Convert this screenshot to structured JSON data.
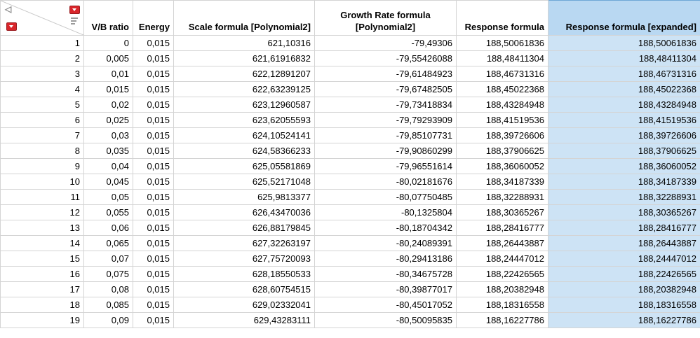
{
  "headers": {
    "vb_ratio": "V/B ratio",
    "energy": "Energy",
    "scale_formula": "Scale formula [Polynomial2]",
    "growth_line1": "Growth Rate formula",
    "growth_line2": "[Polynomial2]",
    "response_formula": "Response formula",
    "response_expanded": "Response formula [expanded]"
  },
  "icons": {
    "collapse": "triangle-left-icon",
    "column_menu": "red-dropdown-icon",
    "row_menu": "red-dropdown-icon",
    "sort": "lines-icon"
  },
  "colors": {
    "selected_column": "#cde3f5",
    "menu_red": "#d9262b"
  },
  "rows": [
    {
      "n": "1",
      "vb": "0",
      "energy": "0,015",
      "scale": "621,10316",
      "growth": "-79,49306",
      "resp": "188,50061836",
      "respx": "188,50061836"
    },
    {
      "n": "2",
      "vb": "0,005",
      "energy": "0,015",
      "scale": "621,61916832",
      "growth": "-79,55426088",
      "resp": "188,48411304",
      "respx": "188,48411304"
    },
    {
      "n": "3",
      "vb": "0,01",
      "energy": "0,015",
      "scale": "622,12891207",
      "growth": "-79,61484923",
      "resp": "188,46731316",
      "respx": "188,46731316"
    },
    {
      "n": "4",
      "vb": "0,015",
      "energy": "0,015",
      "scale": "622,63239125",
      "growth": "-79,67482505",
      "resp": "188,45022368",
      "respx": "188,45022368"
    },
    {
      "n": "5",
      "vb": "0,02",
      "energy": "0,015",
      "scale": "623,12960587",
      "growth": "-79,73418834",
      "resp": "188,43284948",
      "respx": "188,43284948"
    },
    {
      "n": "6",
      "vb": "0,025",
      "energy": "0,015",
      "scale": "623,62055593",
      "growth": "-79,79293909",
      "resp": "188,41519536",
      "respx": "188,41519536"
    },
    {
      "n": "7",
      "vb": "0,03",
      "energy": "0,015",
      "scale": "624,10524141",
      "growth": "-79,85107731",
      "resp": "188,39726606",
      "respx": "188,39726606"
    },
    {
      "n": "8",
      "vb": "0,035",
      "energy": "0,015",
      "scale": "624,58366233",
      "growth": "-79,90860299",
      "resp": "188,37906625",
      "respx": "188,37906625"
    },
    {
      "n": "9",
      "vb": "0,04",
      "energy": "0,015",
      "scale": "625,05581869",
      "growth": "-79,96551614",
      "resp": "188,36060052",
      "respx": "188,36060052"
    },
    {
      "n": "10",
      "vb": "0,045",
      "energy": "0,015",
      "scale": "625,52171048",
      "growth": "-80,02181676",
      "resp": "188,34187339",
      "respx": "188,34187339"
    },
    {
      "n": "11",
      "vb": "0,05",
      "energy": "0,015",
      "scale": "625,9813377",
      "growth": "-80,07750485",
      "resp": "188,32288931",
      "respx": "188,32288931"
    },
    {
      "n": "12",
      "vb": "0,055",
      "energy": "0,015",
      "scale": "626,43470036",
      "growth": "-80,1325804",
      "resp": "188,30365267",
      "respx": "188,30365267"
    },
    {
      "n": "13",
      "vb": "0,06",
      "energy": "0,015",
      "scale": "626,88179845",
      "growth": "-80,18704342",
      "resp": "188,28416777",
      "respx": "188,28416777"
    },
    {
      "n": "14",
      "vb": "0,065",
      "energy": "0,015",
      "scale": "627,32263197",
      "growth": "-80,24089391",
      "resp": "188,26443887",
      "respx": "188,26443887"
    },
    {
      "n": "15",
      "vb": "0,07",
      "energy": "0,015",
      "scale": "627,75720093",
      "growth": "-80,29413186",
      "resp": "188,24447012",
      "respx": "188,24447012"
    },
    {
      "n": "16",
      "vb": "0,075",
      "energy": "0,015",
      "scale": "628,18550533",
      "growth": "-80,34675728",
      "resp": "188,22426565",
      "respx": "188,22426565"
    },
    {
      "n": "17",
      "vb": "0,08",
      "energy": "0,015",
      "scale": "628,60754515",
      "growth": "-80,39877017",
      "resp": "188,20382948",
      "respx": "188,20382948"
    },
    {
      "n": "18",
      "vb": "0,085",
      "energy": "0,015",
      "scale": "629,02332041",
      "growth": "-80,45017052",
      "resp": "188,18316558",
      "respx": "188,18316558"
    },
    {
      "n": "19",
      "vb": "0,09",
      "energy": "0,015",
      "scale": "629,43283111",
      "growth": "-80,50095835",
      "resp": "188,16227786",
      "respx": "188,16227786"
    }
  ]
}
